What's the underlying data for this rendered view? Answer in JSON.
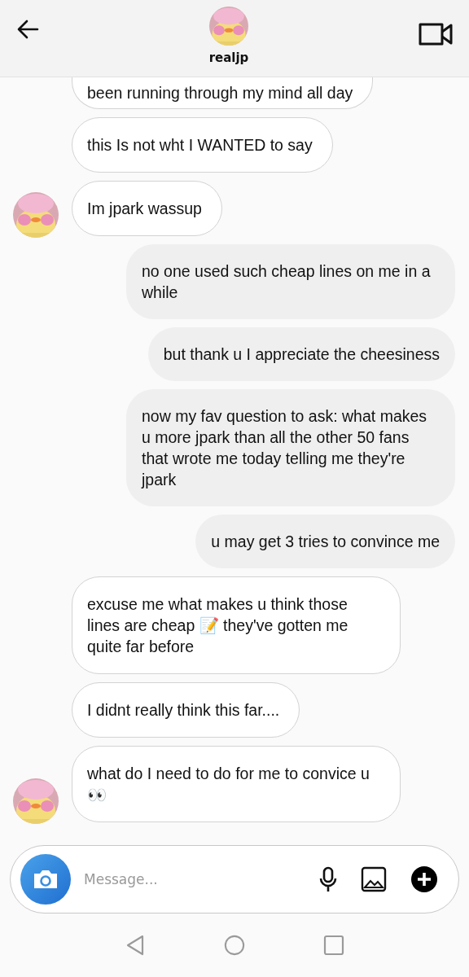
{
  "header": {
    "username": "realjp"
  },
  "messages": [
    {
      "kind": "received",
      "text": "been running through my mind all day",
      "avatar": false,
      "cut": true
    },
    {
      "kind": "received",
      "text": "this Is not wht I WANTED to say",
      "avatar": false,
      "cut": false
    },
    {
      "kind": "received",
      "text": "Im jpark wassup",
      "avatar": true,
      "cut": false
    },
    {
      "kind": "sent",
      "text": "no one used such cheap lines on me in a while",
      "cut": false
    },
    {
      "kind": "sent",
      "text": "but thank u I appreciate the cheesiness",
      "cut": false
    },
    {
      "kind": "sent",
      "text": "now my fav question to ask: what makes u more jpark than all the other 50 fans that wrote me today telling me they're jpark",
      "cut": false
    },
    {
      "kind": "sent",
      "text": "u may get 3 tries to convince me",
      "cut": false
    },
    {
      "kind": "received",
      "text": "excuse me what makes u think those lines are cheap 📝 they've gotten me quite far before",
      "avatar": false,
      "cut": false
    },
    {
      "kind": "received",
      "text": "I didnt really think this far....",
      "avatar": false,
      "cut": false
    },
    {
      "kind": "received",
      "text": "what do I need to do for me to convice u 👀",
      "avatar": true,
      "cut": false
    }
  ],
  "composer": {
    "placeholder": "Message..."
  }
}
